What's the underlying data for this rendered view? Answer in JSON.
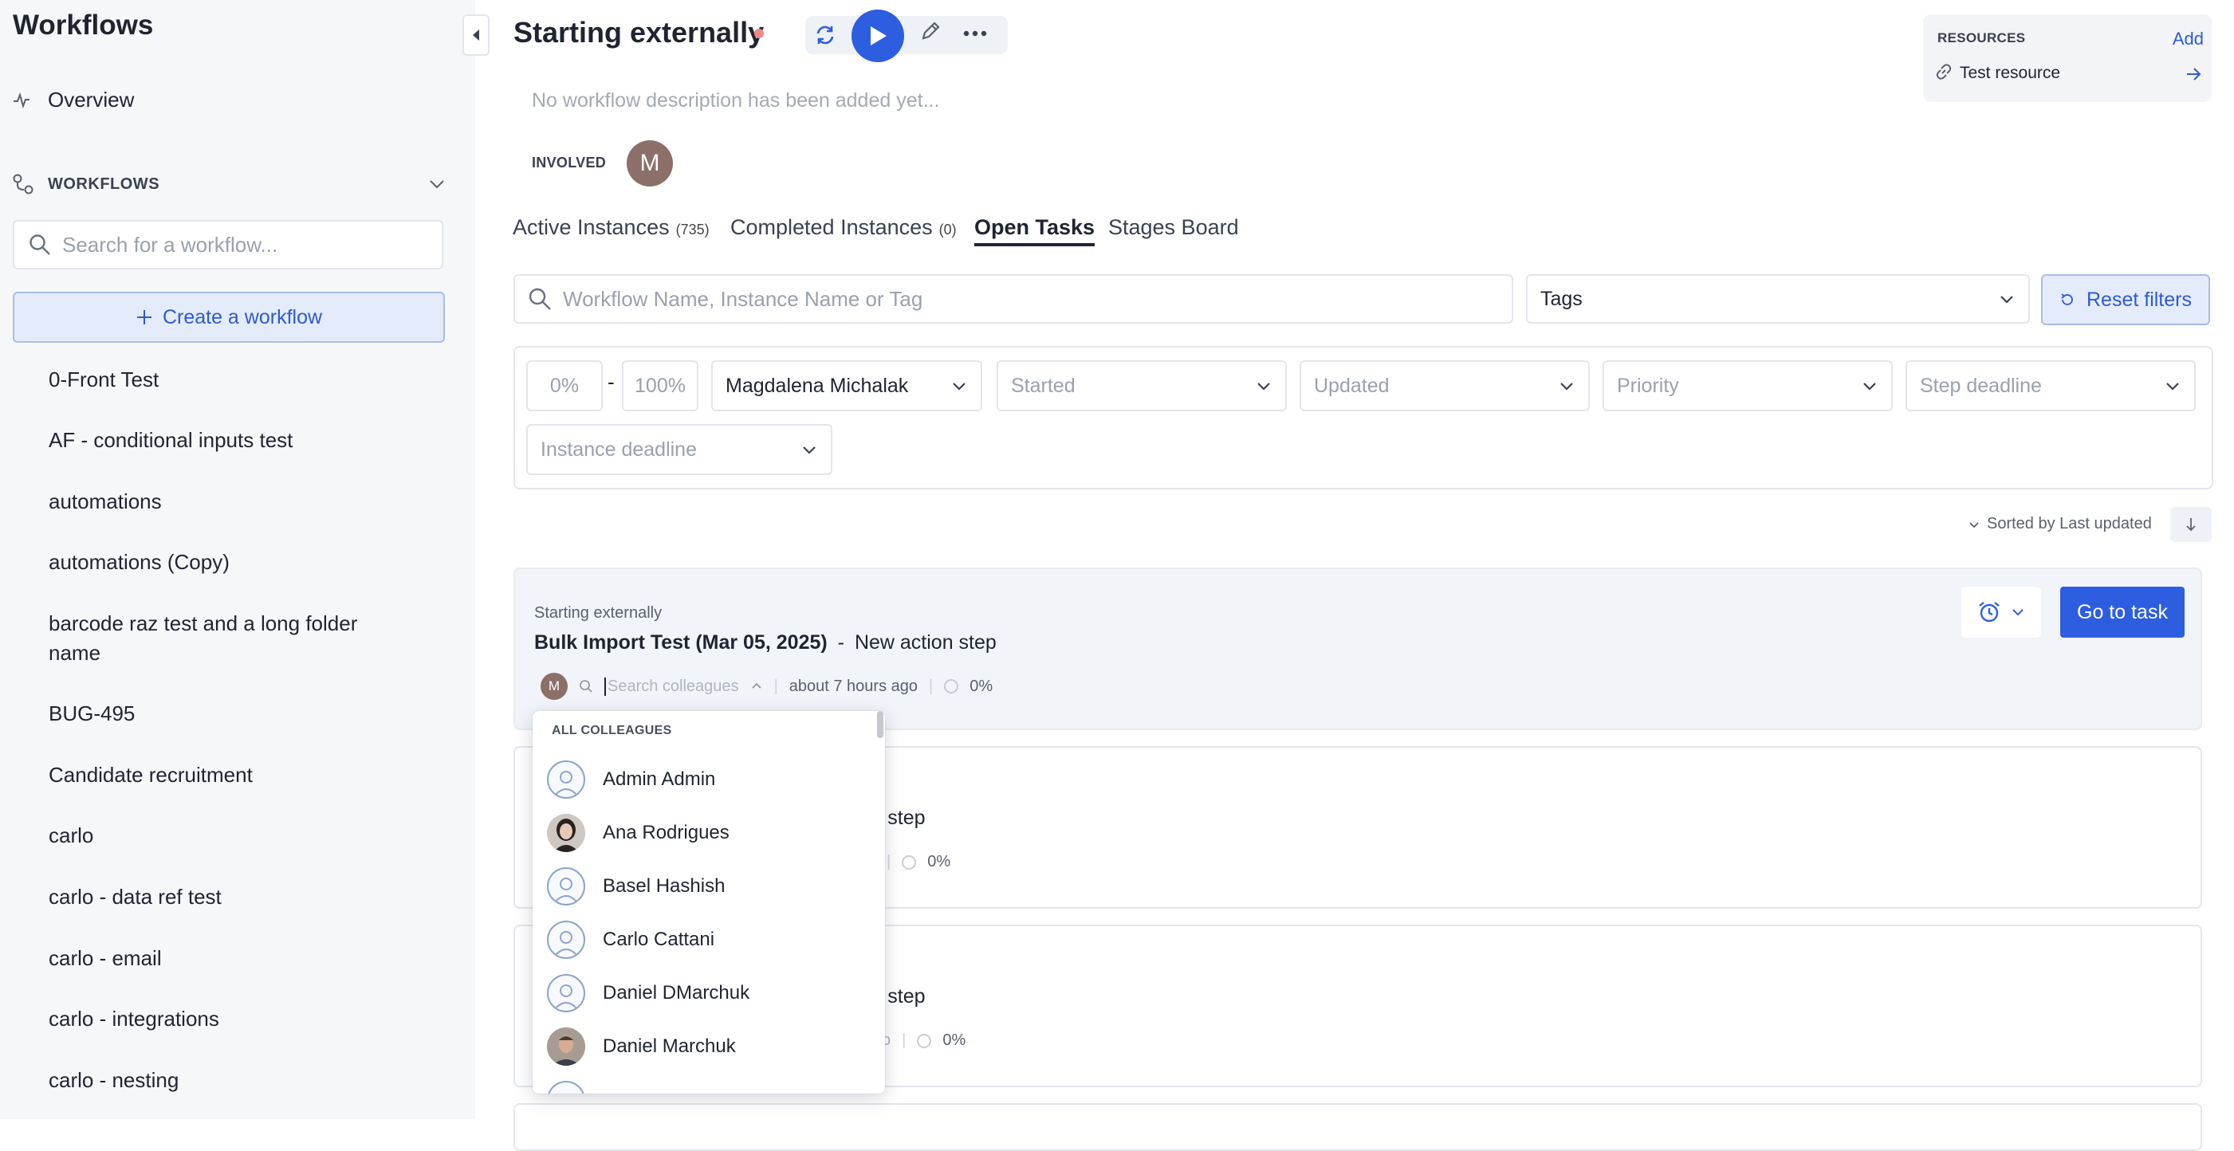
{
  "sidebar": {
    "title": "Workflows",
    "overview_label": "Overview",
    "workflows_heading": "WORKFLOWS",
    "search_placeholder": "Search for a workflow...",
    "create_label": "Create a workflow",
    "items": [
      "0-Front Test",
      "AF - conditional inputs test",
      "automations",
      "automations (Copy)",
      "barcode raz test and a long folder name",
      "BUG-495",
      "Candidate recruitment",
      "carlo",
      "carlo - data ref test",
      "carlo - email",
      "carlo - integrations",
      "carlo - nesting"
    ]
  },
  "header": {
    "title": "Starting externally",
    "description": "No workflow description has been added yet...",
    "involved_label": "INVOLVED",
    "involved_avatar": "M"
  },
  "resources": {
    "label": "RESOURCES",
    "add_label": "Add",
    "item": "Test resource"
  },
  "tabs": [
    {
      "label": "Active Instances",
      "count": "(735)"
    },
    {
      "label": "Completed Instances",
      "count": "(0)"
    },
    {
      "label": "Open Tasks",
      "count": ""
    },
    {
      "label": "Stages Board",
      "count": ""
    }
  ],
  "filters": {
    "search_placeholder": "Workflow Name, Instance Name or Tag",
    "tags": "Tags",
    "reset": "Reset filters",
    "pct_min": "0%",
    "pct_sep": "-",
    "pct_max": "100%",
    "assignee": "Magdalena Michalak",
    "started": "Started",
    "updated": "Updated",
    "priority": "Priority",
    "step_deadline": "Step deadline",
    "instance_deadline": "Instance deadline"
  },
  "sort": {
    "label": "Sorted by Last updated"
  },
  "tasks": [
    {
      "workflow": "Starting externally",
      "instance": "Bulk Import Test (Mar 05, 2025)",
      "separator": "-",
      "step": "New action step",
      "avatar": "M",
      "assign_placeholder": "Search colleagues",
      "updated": "about 7 hours ago",
      "progress": "0%",
      "goto_label": "Go to task"
    },
    {
      "step_visible": "tion step",
      "progress": "0%"
    },
    {
      "step_visible": "tion step",
      "progress": "0%"
    }
  ],
  "colleagues": {
    "heading": "ALL COLLEAGUES",
    "items": [
      {
        "name": "Admin Admin",
        "photo": false
      },
      {
        "name": "Ana Rodrigues",
        "photo": true
      },
      {
        "name": "Basel Hashish",
        "photo": false
      },
      {
        "name": "Carlo Cattani",
        "photo": false
      },
      {
        "name": "Daniel DMarchuk",
        "photo": false
      },
      {
        "name": "Daniel Marchuk",
        "photo": true
      }
    ]
  },
  "colors": {
    "accent": "#2d5ee0",
    "sidebar_bg": "#f6f7f9",
    "status_dot": "#f08a80"
  }
}
